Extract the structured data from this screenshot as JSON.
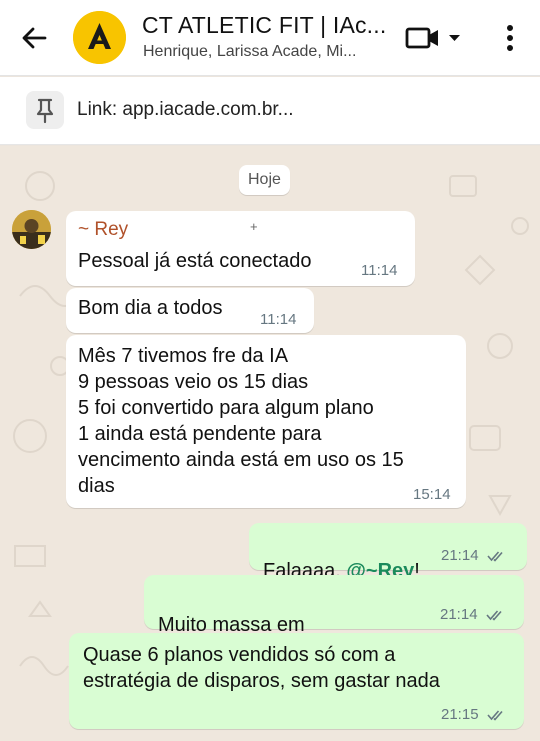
{
  "header": {
    "title": "CT ATLETIC FIT | IAc...",
    "subtitle": "Henrique, Larissa Acade, Mi..."
  },
  "pinned": {
    "text": "Link: app.iacade.com.br..."
  },
  "date_chip": "Hoje",
  "messages": [
    {
      "sender": "~ Rey",
      "phone": "+",
      "text": "Pessoal já está conectado",
      "time": "11:14"
    },
    {
      "text": "Bom dia a todos",
      "time": "11:14"
    },
    {
      "text": "Mês 7 tivemos fre da IA\n9 pessoas veio os 15 dias\n5 foi convertido para algum plano\n1 ainda está pendente para\nvencimento ainda está em uso os 15\ndias",
      "time": "15:14"
    },
    {
      "text_before": "Falaaaa, ",
      "mention": "@~Rey",
      "text_after": "!",
      "time": "21:14"
    },
    {
      "text": "Muito massa em",
      "time": "21:14"
    },
    {
      "text": "Quase 6 planos vendidos só com a\nestratégia de disparos, sem gastar nada",
      "time": "21:15"
    }
  ],
  "colors": {
    "incoming_bubble": "#ffffff",
    "outgoing_bubble": "#d9fdd3",
    "sender_name": "#b0512a",
    "mention": "#1a8a5b",
    "read_ticks": "#667781",
    "chat_background": "#efe7dd"
  },
  "icons": {
    "back": "arrow-left-icon",
    "video": "video-camera-icon",
    "dropdown": "chevron-down-icon",
    "menu": "more-vertical-icon",
    "pin": "pin-icon",
    "reaction": "clapping-hands-icon"
  }
}
